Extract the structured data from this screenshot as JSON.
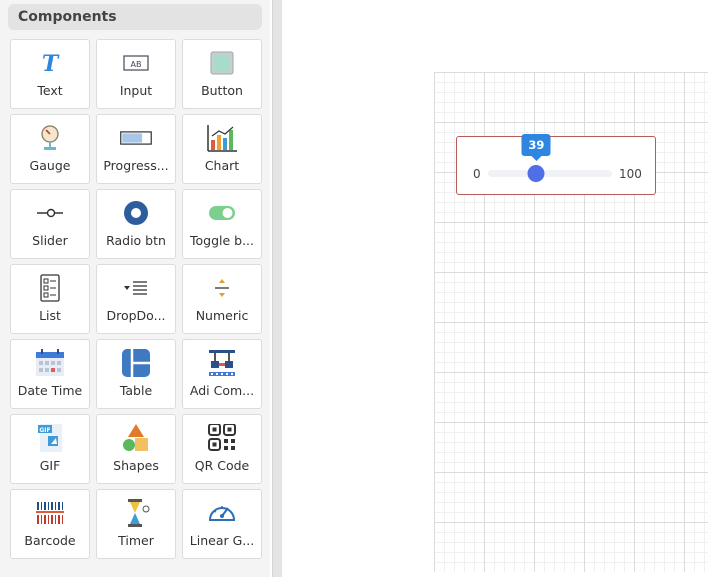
{
  "sidebar": {
    "title": "Components",
    "items": [
      {
        "label": "Text",
        "icon": "text-icon"
      },
      {
        "label": "Input",
        "icon": "input-icon"
      },
      {
        "label": "Button",
        "icon": "button-icon"
      },
      {
        "label": "Gauge",
        "icon": "gauge-icon"
      },
      {
        "label": "Progress...",
        "icon": "progress-bar-icon"
      },
      {
        "label": "Chart",
        "icon": "chart-icon"
      },
      {
        "label": "Slider",
        "icon": "slider-icon"
      },
      {
        "label": "Radio btn",
        "icon": "radio-button-icon"
      },
      {
        "label": "Toggle b...",
        "icon": "toggle-icon"
      },
      {
        "label": "List",
        "icon": "list-icon"
      },
      {
        "label": "DropDo...",
        "icon": "dropdown-icon"
      },
      {
        "label": "Numeric",
        "icon": "numeric-icon"
      },
      {
        "label": "Date Time",
        "icon": "calendar-icon"
      },
      {
        "label": "Table",
        "icon": "table-icon"
      },
      {
        "label": "Adi Com...",
        "icon": "adi-component-icon"
      },
      {
        "label": "GIF",
        "icon": "gif-icon"
      },
      {
        "label": "Shapes",
        "icon": "shapes-icon"
      },
      {
        "label": "QR Code",
        "icon": "qr-code-icon"
      },
      {
        "label": "Barcode",
        "icon": "barcode-icon"
      },
      {
        "label": "Timer",
        "icon": "timer-icon"
      },
      {
        "label": "Linear G...",
        "icon": "linear-gauge-icon"
      }
    ]
  },
  "slider": {
    "min": "0",
    "max": "100",
    "value": "39",
    "value_fraction": 0.39,
    "thumb_color": "#4e6fe6",
    "tooltip_color": "#2f86e0",
    "border_color": "#b85a5a"
  }
}
